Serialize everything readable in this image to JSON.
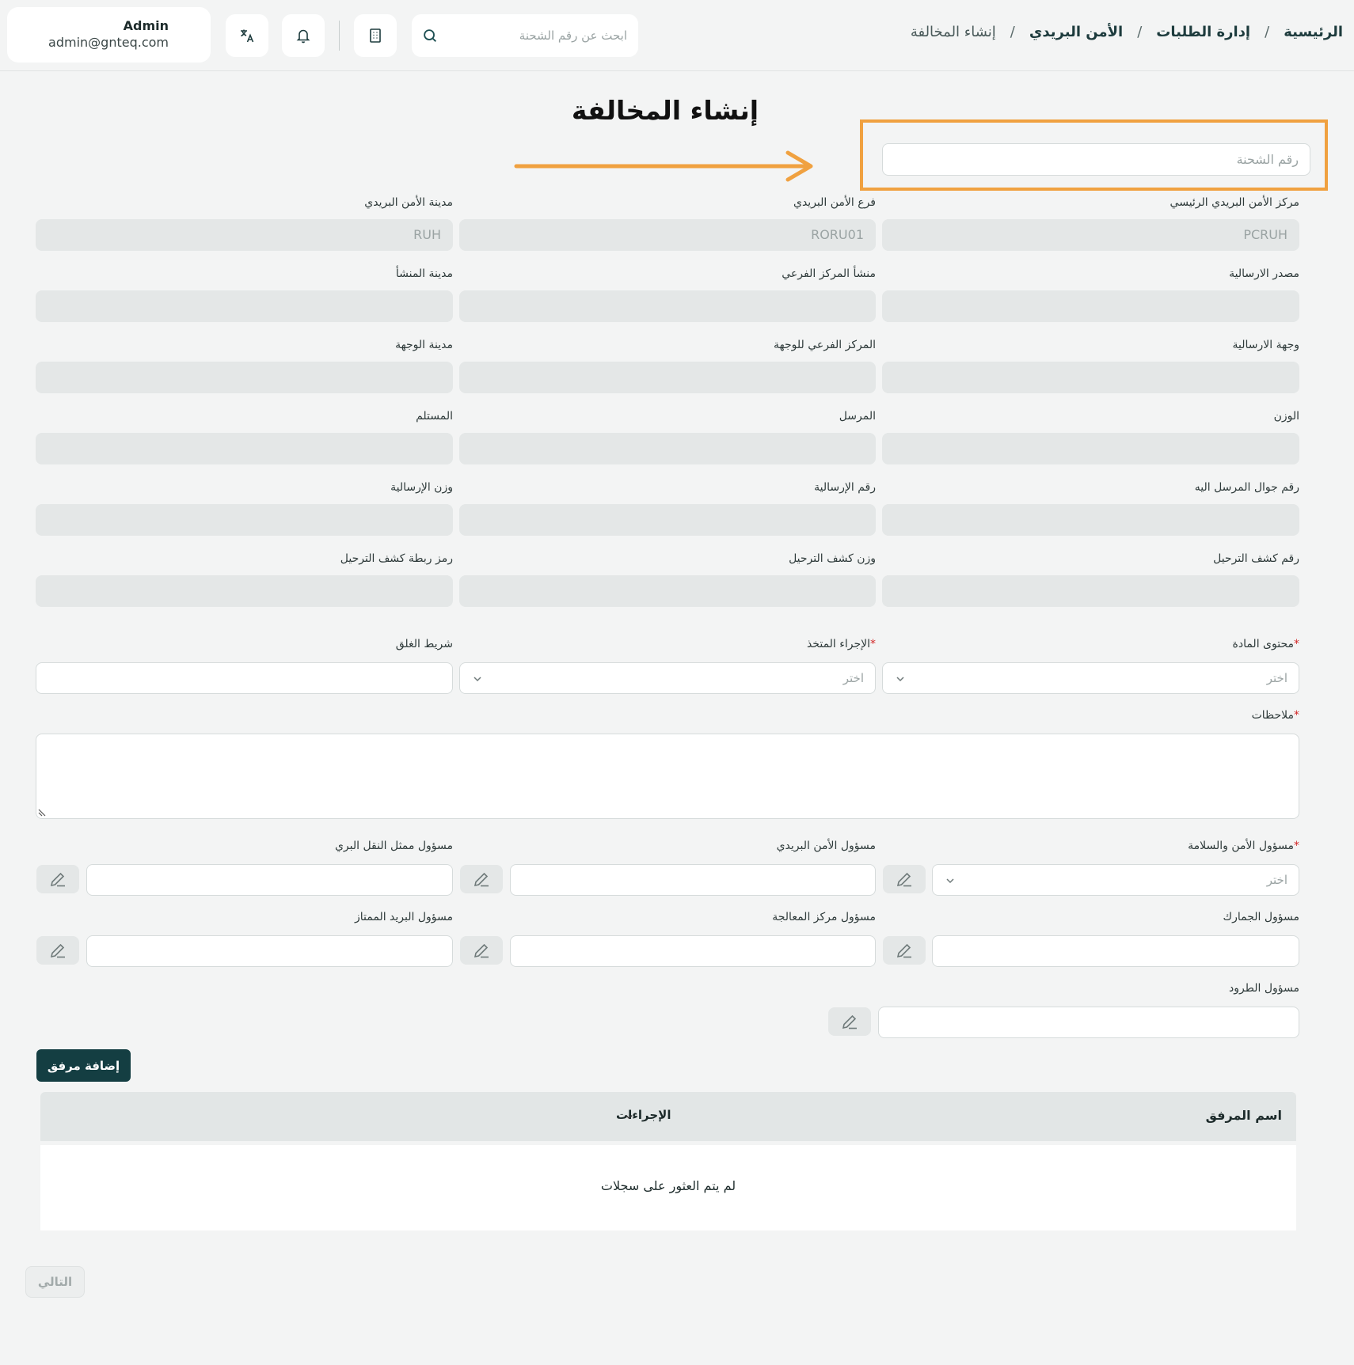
{
  "header": {
    "breadcrumb": [
      "الرئيسية",
      "إدارة الطلبات",
      "الأمن البريدي",
      "إنشاء المخالفة"
    ],
    "search_placeholder": "ابحث عن رقم الشحنة",
    "user": {
      "name": "Admin",
      "email": "admin@gnteq.com"
    }
  },
  "page": {
    "title": "إنشاء المخالفة",
    "shipment_placeholder": "رقم الشحنة",
    "highlight_color": "#f0a140"
  },
  "fields": {
    "main_center": {
      "label": "مركز الأمن البريدي الرئيسي",
      "value": "PCRUH"
    },
    "branch": {
      "label": "فرع الأمن البريدي",
      "value": "RORU01"
    },
    "city": {
      "label": "مدينة الأمن البريدي",
      "value": "RUH"
    },
    "source": {
      "label": "مصدر الارسالية",
      "value": ""
    },
    "origin_sub": {
      "label": "منشأ المركز الفرعي",
      "value": ""
    },
    "origin_city": {
      "label": "مدينة المنشأ",
      "value": ""
    },
    "destination": {
      "label": "وجهة الارسالية",
      "value": ""
    },
    "dest_sub": {
      "label": "المركز الفرعي للوجهة",
      "value": ""
    },
    "dest_city": {
      "label": "مدينة الوجهة",
      "value": ""
    },
    "weight": {
      "label": "الوزن",
      "value": ""
    },
    "sender": {
      "label": "المرسل",
      "value": ""
    },
    "receiver": {
      "label": "المستلم",
      "value": ""
    },
    "recipient_mobile": {
      "label": "رقم جوال المرسل اليه",
      "value": ""
    },
    "shipment_no": {
      "label": "رقم الإرسالية",
      "value": ""
    },
    "shipment_weight": {
      "label": "وزن الإرسالية",
      "value": ""
    },
    "manifest_no": {
      "label": "رقم كشف الترحيل",
      "value": ""
    },
    "manifest_weight": {
      "label": "وزن كشف الترحيل",
      "value": ""
    },
    "manifest_link": {
      "label": "رمز ربطة كشف الترحيل",
      "value": ""
    },
    "material": {
      "label": "محتوى المادة",
      "placeholder": "اختر"
    },
    "action_taken": {
      "label": "الإجراء المتخذ",
      "placeholder": "اختر"
    },
    "seal_tape": {
      "label": "شريط الغلق",
      "value": ""
    },
    "notes": {
      "label": "ملاحظات",
      "value": ""
    },
    "safety_officer": {
      "label": "مسؤول الأمن والسلامة",
      "placeholder": "اختر"
    },
    "postal_officer": {
      "label": "مسؤول الأمن البريدي",
      "value": ""
    },
    "land_transport": {
      "label": "مسؤول ممثل النقل البري",
      "value": ""
    },
    "customs_officer": {
      "label": "مسؤول الجمارك",
      "value": ""
    },
    "processing_officer": {
      "label": "مسؤول مركز المعالجة",
      "value": ""
    },
    "premium_officer": {
      "label": "مسؤول البريد الممتاز",
      "value": ""
    },
    "parcels_officer": {
      "label": "مسؤول الطرود",
      "value": ""
    }
  },
  "required_marker": "*",
  "attachments": {
    "add_button": "إضافة مرفق",
    "col_name": "اسم المرفق",
    "col_actions": "الإجراءات",
    "empty": "لم يتم العثور على سجلات"
  },
  "next_button": "التالي",
  "colors": {
    "primary": "#143e42",
    "required": "#d22727",
    "disabled_field": "#e4e7e7"
  }
}
